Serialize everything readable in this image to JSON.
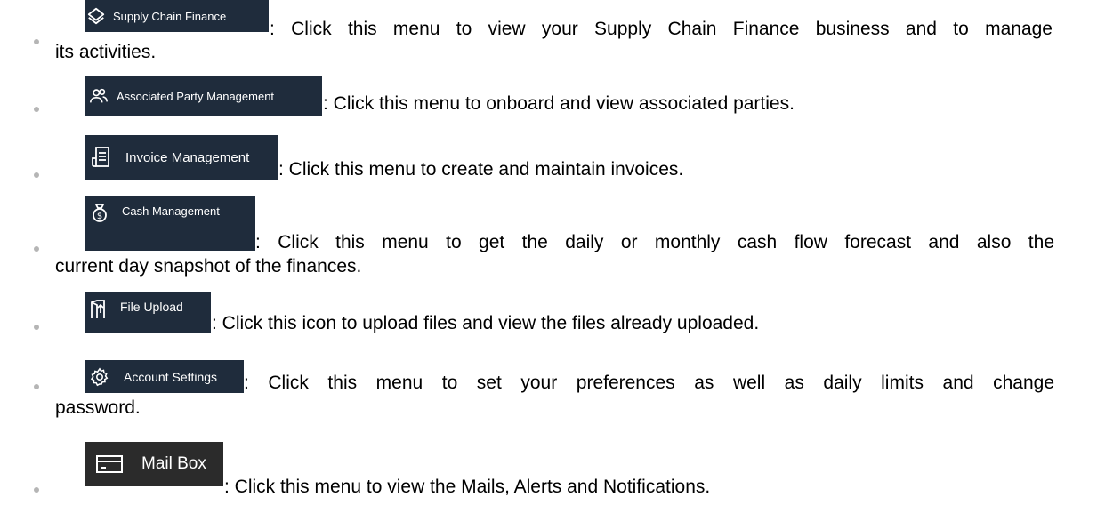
{
  "items": [
    {
      "chip_label": "Supply Chain Finance",
      "icon": "layers-icon",
      "chip_color": "#1f2c3c",
      "line1": ": Click this menu to view your Supply Chain Finance business and to manage",
      "line2": "its activities."
    },
    {
      "chip_label": "Associated Party Management",
      "icon": "users-icon",
      "chip_color": "#1f2c3c",
      "line1": ": Click this menu to onboard and view associated parties."
    },
    {
      "chip_label": "Invoice Management",
      "icon": "invoice-icon",
      "chip_color": "#1f2c3c",
      "line1": ": Click this menu to create and maintain invoices."
    },
    {
      "chip_label": "Cash Management",
      "icon": "money-bag-icon",
      "chip_color": "#1f2c3c",
      "line1": ": Click this menu to get the daily or monthly cash flow forecast and also the",
      "line2": "current day snapshot of the finances."
    },
    {
      "chip_label": "File Upload",
      "icon": "file-upload-icon",
      "chip_color": "#1f2c3c",
      "line1": ": Click this icon to upload files and view the files already uploaded."
    },
    {
      "chip_label": "Account Settings",
      "icon": "gear-icon",
      "chip_color": "#1f2c3c",
      "line1": ": Click this menu to set your preferences as well as daily limits and change",
      "line2": "password."
    },
    {
      "chip_label": "Mail Box",
      "icon": "mailbox-icon",
      "chip_color": "#2b2b2b",
      "line1": ": Click this menu to view the Mails, Alerts and Notifications."
    }
  ]
}
